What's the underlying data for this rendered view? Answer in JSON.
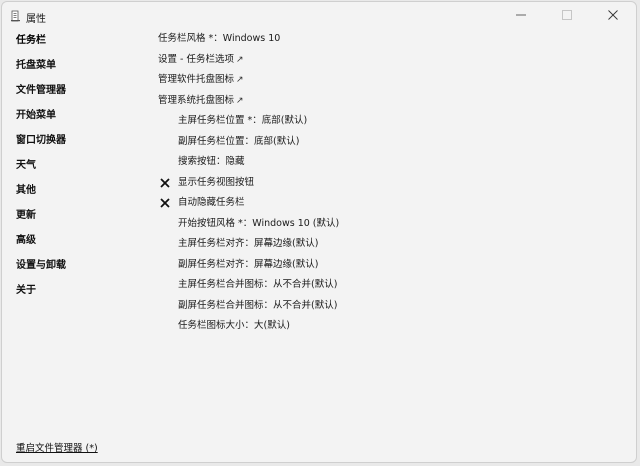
{
  "window": {
    "title": "属性"
  },
  "sidebar": {
    "items": [
      {
        "label": "任务栏"
      },
      {
        "label": "托盘菜单"
      },
      {
        "label": "文件管理器"
      },
      {
        "label": "开始菜单"
      },
      {
        "label": "窗口切换器"
      },
      {
        "label": "天气"
      },
      {
        "label": "其他"
      },
      {
        "label": "更新"
      },
      {
        "label": "高级"
      },
      {
        "label": "设置与卸载"
      },
      {
        "label": "关于"
      }
    ],
    "footer_link": "重启文件管理器 (*)"
  },
  "settings": {
    "taskbar_style": "任务栏风格 *：Windows 10",
    "taskbar_options": "设置 - 任务栏选项",
    "manage_tray_icons": "管理软件托盘图标",
    "manage_system_tray_icons": "管理系统托盘图标",
    "primary_taskbar_position": "主屏任务栏位置 *：底部(默认)",
    "secondary_taskbar_position": "副屏任务栏位置：底部(默认)",
    "search_button": "搜索按钮：隐藏",
    "show_task_view_button": "显示任务视图按钮",
    "auto_hide_taskbar": "自动隐藏任务栏",
    "start_button_style": "开始按钮风格 *：Windows 10 (默认)",
    "primary_taskbar_alignment": "主屏任务栏对齐：屏幕边缘(默认)",
    "secondary_taskbar_alignment": "副屏任务栏对齐：屏幕边缘(默认)",
    "primary_combine_icons": "主屏任务栏合并图标：从不合并(默认)",
    "secondary_combine_icons": "副屏任务栏合并图标：从不合并(默认)",
    "taskbar_icon_size": "任务栏图标大小：大(默认)",
    "external_link_glyph": "↗"
  },
  "icons": {
    "app": "app-icon",
    "minimize": "minimize-icon",
    "maximize": "maximize-icon",
    "close": "close-icon",
    "unchecked": "x-mark-icon",
    "external": "external-link-icon"
  }
}
